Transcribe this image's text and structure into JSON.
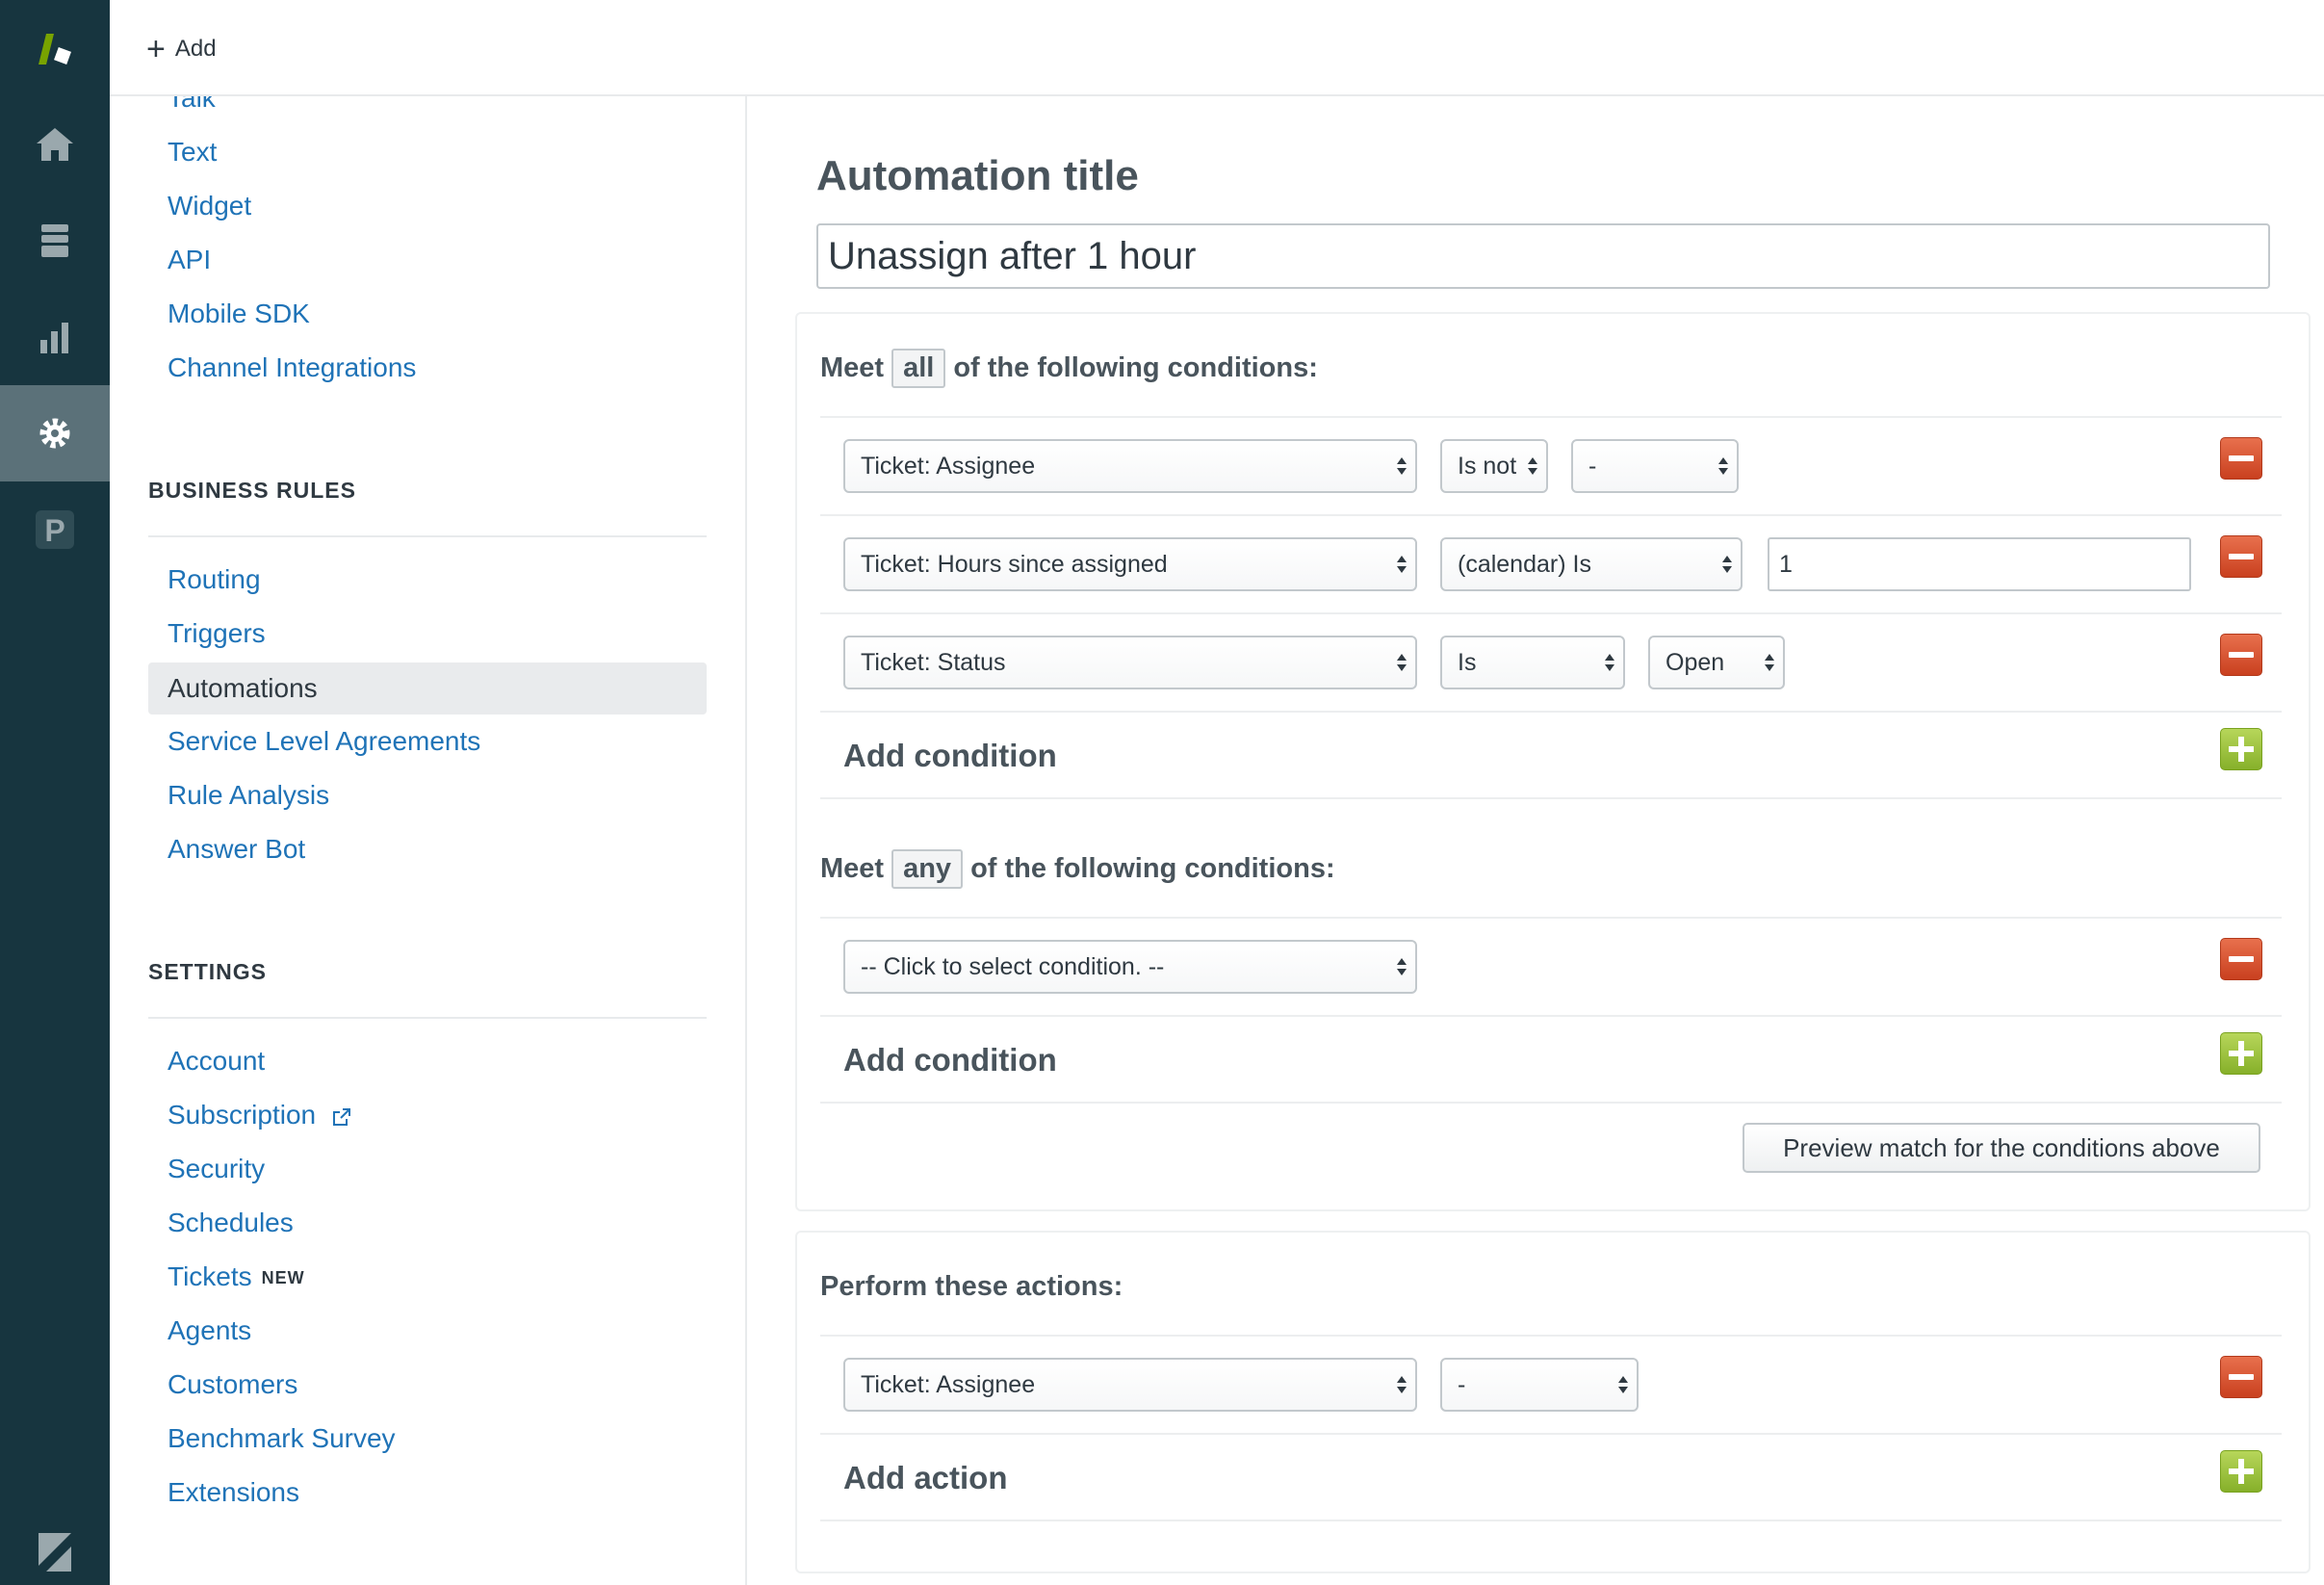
{
  "topbar": {
    "add_label": "Add"
  },
  "rail": {
    "icons": [
      "zendesk-logo-icon",
      "home-icon",
      "views-icon",
      "reporting-icon",
      "admin-gear-icon",
      "product-p-icon",
      "zendesk-z-icon"
    ],
    "active": "admin-gear-icon",
    "colors": {
      "background": "#17353f",
      "active_bg": "#5b7179",
      "logo_green": "#78a300"
    }
  },
  "adminnav": {
    "channels": [
      "Talk",
      "Text",
      "Widget",
      "API",
      "Mobile SDK",
      "Channel Integrations"
    ],
    "business_rules": {
      "heading": "BUSINESS RULES",
      "items": [
        "Routing",
        "Triggers",
        "Automations",
        "Service Level Agreements",
        "Rule Analysis",
        "Answer Bot"
      ],
      "active": "Automations"
    },
    "settings": {
      "heading": "SETTINGS",
      "items": [
        "Account",
        "Subscription",
        "Security",
        "Schedules",
        "Tickets",
        "Agents",
        "Customers",
        "Benchmark Survey",
        "Extensions"
      ],
      "tickets_badge": "NEW"
    }
  },
  "main": {
    "title_label": "Automation title",
    "title_value": "Unassign after 1 hour",
    "all_block": {
      "prefix": "Meet",
      "chip": "all",
      "suffix": "of the following conditions:",
      "rows": [
        {
          "field": "Ticket: Assignee",
          "operator": "Is not",
          "value": "-"
        },
        {
          "field": "Ticket: Hours since assigned",
          "operator": "(calendar) Is",
          "value": "1"
        },
        {
          "field": "Ticket: Status",
          "operator": "Is",
          "value": "Open"
        }
      ],
      "add_label": "Add condition"
    },
    "any_block": {
      "prefix": "Meet",
      "chip": "any",
      "suffix": "of the following conditions:",
      "rows": [
        {
          "field": "-- Click to select condition. --"
        }
      ],
      "add_label": "Add condition"
    },
    "preview_button": "Preview match for the conditions above",
    "actions": {
      "label": "Perform these actions:",
      "rows": [
        {
          "field": "Ticket: Assignee",
          "value": "-"
        }
      ],
      "add_label": "Add action"
    }
  },
  "colors": {
    "link": "#1f73b7",
    "remove": "#d9532c",
    "add": "#9cc33b"
  }
}
